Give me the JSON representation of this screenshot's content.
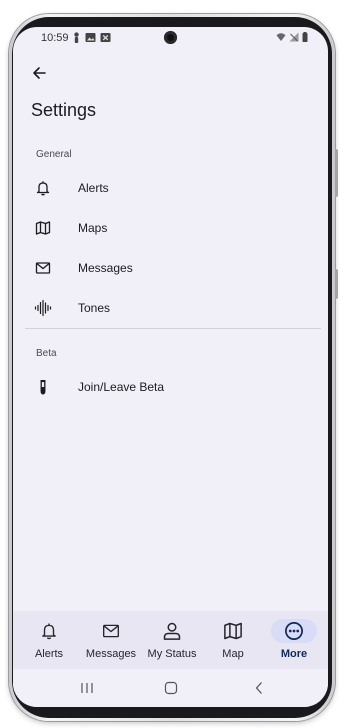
{
  "status_bar": {
    "time": "10:59"
  },
  "app_bar": {
    "back_label": "Back"
  },
  "page": {
    "title": "Settings"
  },
  "sections": [
    {
      "header": "General",
      "items": [
        {
          "label": "Alerts",
          "icon": "bell-icon"
        },
        {
          "label": "Maps",
          "icon": "map-icon"
        },
        {
          "label": "Messages",
          "icon": "mail-icon"
        },
        {
          "label": "Tones",
          "icon": "waveform-icon"
        }
      ]
    },
    {
      "header": "Beta",
      "items": [
        {
          "label": "Join/Leave Beta",
          "icon": "test-tube-icon"
        }
      ]
    }
  ],
  "bottom_nav": {
    "active": "More",
    "items": [
      {
        "label": "Alerts",
        "icon": "bell-icon"
      },
      {
        "label": "Messages",
        "icon": "mail-icon"
      },
      {
        "label": "My Status",
        "icon": "person-icon"
      },
      {
        "label": "Map",
        "icon": "map-icon"
      },
      {
        "label": "More",
        "icon": "more-horizontal-circle-icon"
      }
    ]
  },
  "colors": {
    "screen_bg": "#f1eff7",
    "nav_bg": "#e8e6f2",
    "active_pill": "#d9dcf6",
    "active_label": "#102a5c"
  }
}
